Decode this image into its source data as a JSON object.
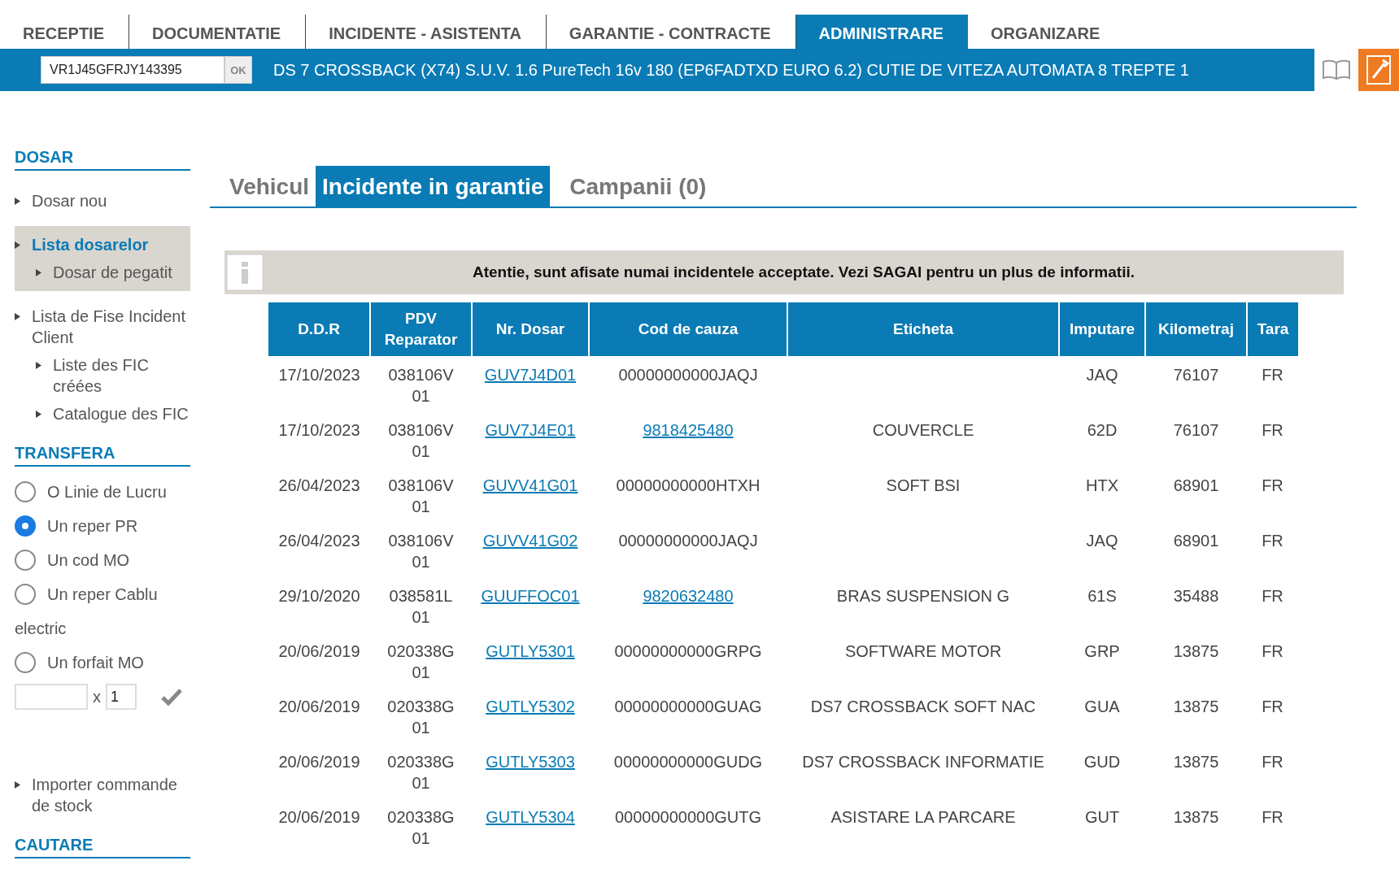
{
  "top_tabs": [
    {
      "label": "RECEPTIE",
      "selected": false
    },
    {
      "label": "DOCUMENTATIE",
      "selected": false
    },
    {
      "label": "INCIDENTE - ASISTENTA",
      "selected": false
    },
    {
      "label": "GARANTIE - CONTRACTE",
      "selected": false
    },
    {
      "label": "ADMINISTRARE",
      "selected": true
    },
    {
      "label": "ORGANIZARE",
      "selected": false
    }
  ],
  "vin_bar": {
    "vin": "VR1J45GFRJY143395",
    "ok": "OK",
    "vehicle": "DS 7 CROSSBACK (X74) S.U.V. 1.6 PureTech 16v 180 (EP6FADTXD EURO 6.2) CUTIE DE VITEZA AUTOMATA 8 TREPTE 1"
  },
  "sidebar": {
    "sections": [
      {
        "title": "DOSAR",
        "items": [
          {
            "label": "Dosar nou",
            "selected": false
          },
          {
            "label": "Lista dosarelor",
            "selected": true,
            "children": [
              {
                "label": "Dosar de pegatit",
                "selected": false
              }
            ]
          },
          {
            "label": "Lista de Fise Incident Client",
            "selected": false,
            "children": [
              {
                "label": "Liste des FIC créées",
                "selected": false
              },
              {
                "label": "Catalogue des FIC",
                "selected": false
              }
            ]
          }
        ]
      },
      {
        "title": "TRANSFERA",
        "radios": [
          {
            "label": "O Linie de Lucru",
            "selected": false
          },
          {
            "label": "Un reper PR",
            "selected": true
          },
          {
            "label": "Un cod MO",
            "selected": false
          },
          {
            "label": "Un reper Cablu",
            "selected": false,
            "continuation": "electric"
          },
          {
            "label": "Un forfait MO",
            "selected": false
          }
        ],
        "times": "x",
        "quantity": "1",
        "items": [
          {
            "label": "Importer commande de stock",
            "selected": false
          }
        ]
      },
      {
        "title": "CAUTARE"
      }
    ]
  },
  "content_tabs": [
    {
      "label": "Vehicul",
      "selected": false
    },
    {
      "label": "Incidente in garantie",
      "selected": true
    },
    {
      "label": "Campanii (0)",
      "selected": false
    }
  ],
  "notice": "Atentie, sunt afisate numai incidentele acceptate. Vezi SAGAI pentru un plus de informatii.",
  "table": {
    "columns": [
      "D.D.R",
      "PDV Reparator",
      "Nr. Dosar",
      "Cod de cauza",
      "Eticheta",
      "Imputare",
      "Kilometraj",
      "Tara"
    ],
    "rows": [
      {
        "ddr": "17/10/2023",
        "pdv": [
          "038106V",
          "01"
        ],
        "dosar": "GUV7J4D01",
        "cod": "00000000000JAQJ",
        "cod_link": false,
        "eticheta": "",
        "imputare": "JAQ",
        "km": "76107",
        "tara": "FR"
      },
      {
        "ddr": "17/10/2023",
        "pdv": [
          "038106V",
          "01"
        ],
        "dosar": "GUV7J4E01",
        "cod": "9818425480",
        "cod_link": true,
        "eticheta": "COUVERCLE",
        "imputare": "62D",
        "km": "76107",
        "tara": "FR"
      },
      {
        "ddr": "26/04/2023",
        "pdv": [
          "038106V",
          "01"
        ],
        "dosar": "GUVV41G01",
        "cod": "00000000000HTXH",
        "cod_link": false,
        "eticheta": "SOFT BSI",
        "imputare": "HTX",
        "km": "68901",
        "tara": "FR"
      },
      {
        "ddr": "26/04/2023",
        "pdv": [
          "038106V",
          "01"
        ],
        "dosar": "GUVV41G02",
        "cod": "00000000000JAQJ",
        "cod_link": false,
        "eticheta": "",
        "imputare": "JAQ",
        "km": "68901",
        "tara": "FR"
      },
      {
        "ddr": "29/10/2020",
        "pdv": [
          "038581L",
          "01"
        ],
        "dosar": "GUUFFOC01",
        "cod": "9820632480",
        "cod_link": true,
        "eticheta": "BRAS SUSPENSION G",
        "imputare": "61S",
        "km": "35488",
        "tara": "FR"
      },
      {
        "ddr": "20/06/2019",
        "pdv": [
          "020338G",
          "01"
        ],
        "dosar": "GUTLY5301",
        "cod": "00000000000GRPG",
        "cod_link": false,
        "eticheta": "SOFTWARE MOTOR",
        "imputare": "GRP",
        "km": "13875",
        "tara": "FR"
      },
      {
        "ddr": "20/06/2019",
        "pdv": [
          "020338G",
          "01"
        ],
        "dosar": "GUTLY5302",
        "cod": "00000000000GUAG",
        "cod_link": false,
        "eticheta": "DS7 CROSSBACK SOFT NAC",
        "imputare": "GUA",
        "km": "13875",
        "tara": "FR"
      },
      {
        "ddr": "20/06/2019",
        "pdv": [
          "020338G",
          "01"
        ],
        "dosar": "GUTLY5303",
        "cod": "00000000000GUDG",
        "cod_link": false,
        "eticheta": "DS7 CROSSBACK INFORMATIE",
        "imputare": "GUD",
        "km": "13875",
        "tara": "FR"
      },
      {
        "ddr": "20/06/2019",
        "pdv": [
          "020338G",
          "01"
        ],
        "dosar": "GUTLY5304",
        "cod": "00000000000GUTG",
        "cod_link": false,
        "eticheta": "ASISTARE LA PARCARE",
        "imputare": "GUT",
        "km": "13875",
        "tara": "FR"
      }
    ]
  }
}
